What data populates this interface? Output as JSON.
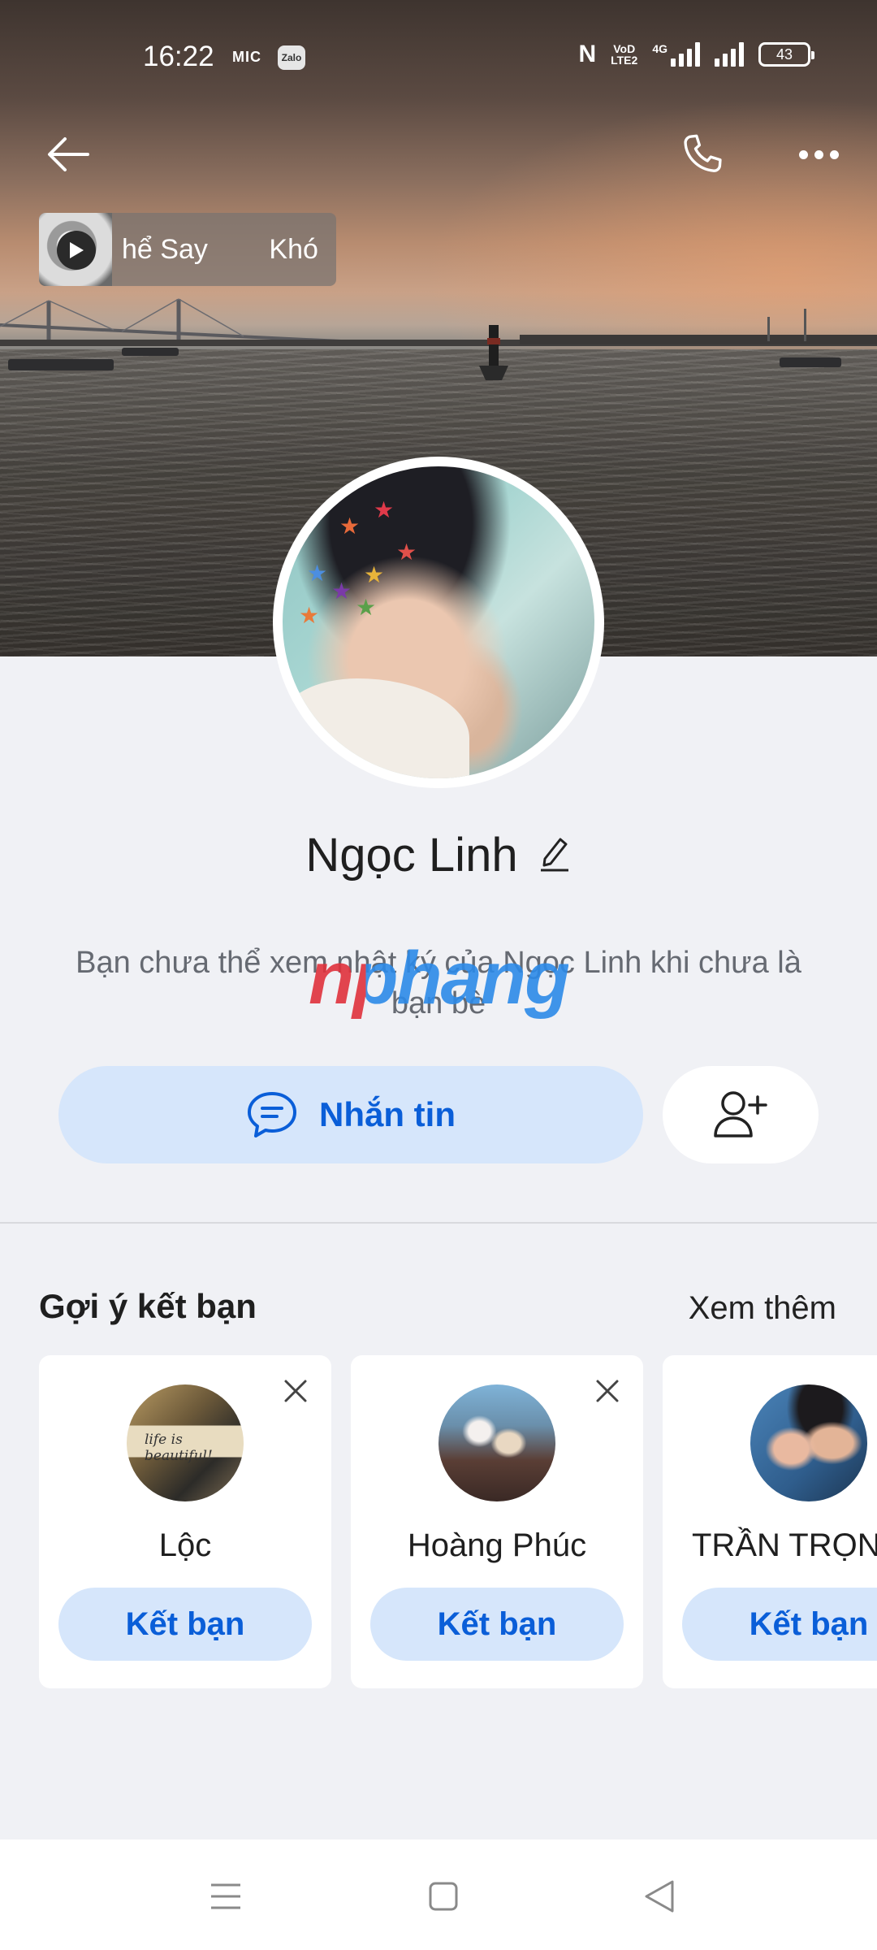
{
  "status_bar": {
    "time": "16:22",
    "mic_label": "MIC",
    "app_badge": "Zalo",
    "nfc": "N",
    "volte_top": "VoD",
    "volte_bottom": "LTE2",
    "network": "4G",
    "battery": "43"
  },
  "profile": {
    "music_title": "hể Say        Khó",
    "name": "Ngọc Linh",
    "privacy_note": "Bạn chưa thể xem nhật ký của Ngọc Linh khi chưa là bạn bè",
    "message_button": "Nhắn tin"
  },
  "watermark": "nphang",
  "suggestions": {
    "title": "Gợi ý kết bạn",
    "see_more": "Xem thêm",
    "items": [
      {
        "name": "Lộc",
        "button": "Kết bạn",
        "avatar_text": "life is beautiful!"
      },
      {
        "name": "Hoàng Phúc",
        "button": "Kết bạn"
      },
      {
        "name": "TRẦN TRỌNG",
        "button": "Kết bạn"
      }
    ]
  },
  "colors": {
    "accent": "#0a5ed8",
    "accent_light": "#d6e6fb",
    "background": "#f0f1f5",
    "card": "#ffffff"
  },
  "icons": [
    "back-arrow-icon",
    "phone-icon",
    "more-dots-icon",
    "play-icon",
    "edit-pencil-icon",
    "chat-bubble-icon",
    "add-user-icon",
    "close-icon",
    "menu-icon",
    "home-square-icon",
    "back-triangle-icon"
  ]
}
